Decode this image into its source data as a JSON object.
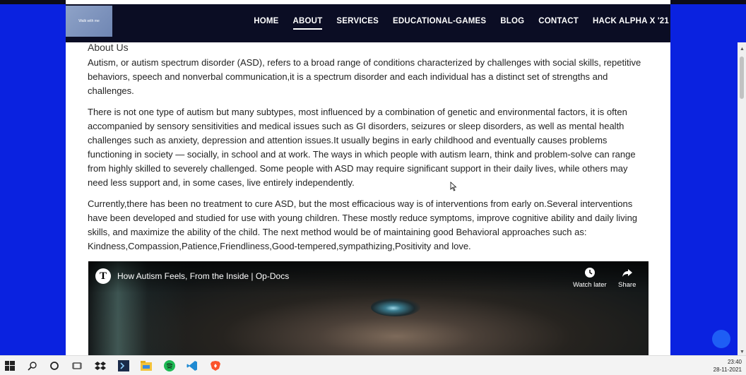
{
  "nav": {
    "logo_text": "Walk with me",
    "items": [
      {
        "label": "HOME"
      },
      {
        "label": "ABOUT"
      },
      {
        "label": "SERVICES"
      },
      {
        "label": "EDUCATIONAL-GAMES"
      },
      {
        "label": "BLOG"
      },
      {
        "label": "CONTACT"
      },
      {
        "label": "HACK ALPHA X '21"
      }
    ],
    "active": "ABOUT"
  },
  "content": {
    "heading": "About Us",
    "paragraphs": [
      "Autism, or autism spectrum disorder (ASD), refers to a broad range of conditions characterized by challenges with social skills, repetitive behaviors, speech and nonverbal communication,it is a spectrum disorder and each individual has a distinct set of strengths and challenges.",
      "There is not one type of autism but many subtypes, most influenced by a combination of genetic and environmental factors, it is often accompanied by sensory sensitivities and medical issues such as GI disorders, seizures or sleep disorders, as well as mental health challenges such as anxiety, depression and attention issues.It usually begins in early childhood and eventually causes problems functioning in society — socially, in school and at work. The ways in which people with autism learn, think and problem-solve can range from highly skilled to severely challenged. Some people with ASD may require significant support in their daily lives, while others may need less support and, in some cases, live entirely independently.",
      "Currently,there has been no treatment to cure ASD, but the most efficacious way is of interventions from early on.Several interventions have been developed and studied for use with young children. These mostly reduce symptoms, improve cognitive ability and daily living skills, and maximize the ability of the child. The next method would be of maintaining good Behavioral approaches such as: Kindness,Compassion,Patience,Friendliness,Good-tempered,sympathizing,Positivity and love."
    ]
  },
  "video": {
    "title": "How Autism Feels, From the Inside | Op-Docs",
    "watch_later": "Watch later",
    "share": "Share"
  },
  "taskbar": {
    "time": "23:40",
    "date": "28-11-2021"
  },
  "colors": {
    "background": "#0a22e0",
    "navbar": "#0b0d24",
    "fab": "#1e5ef5"
  }
}
